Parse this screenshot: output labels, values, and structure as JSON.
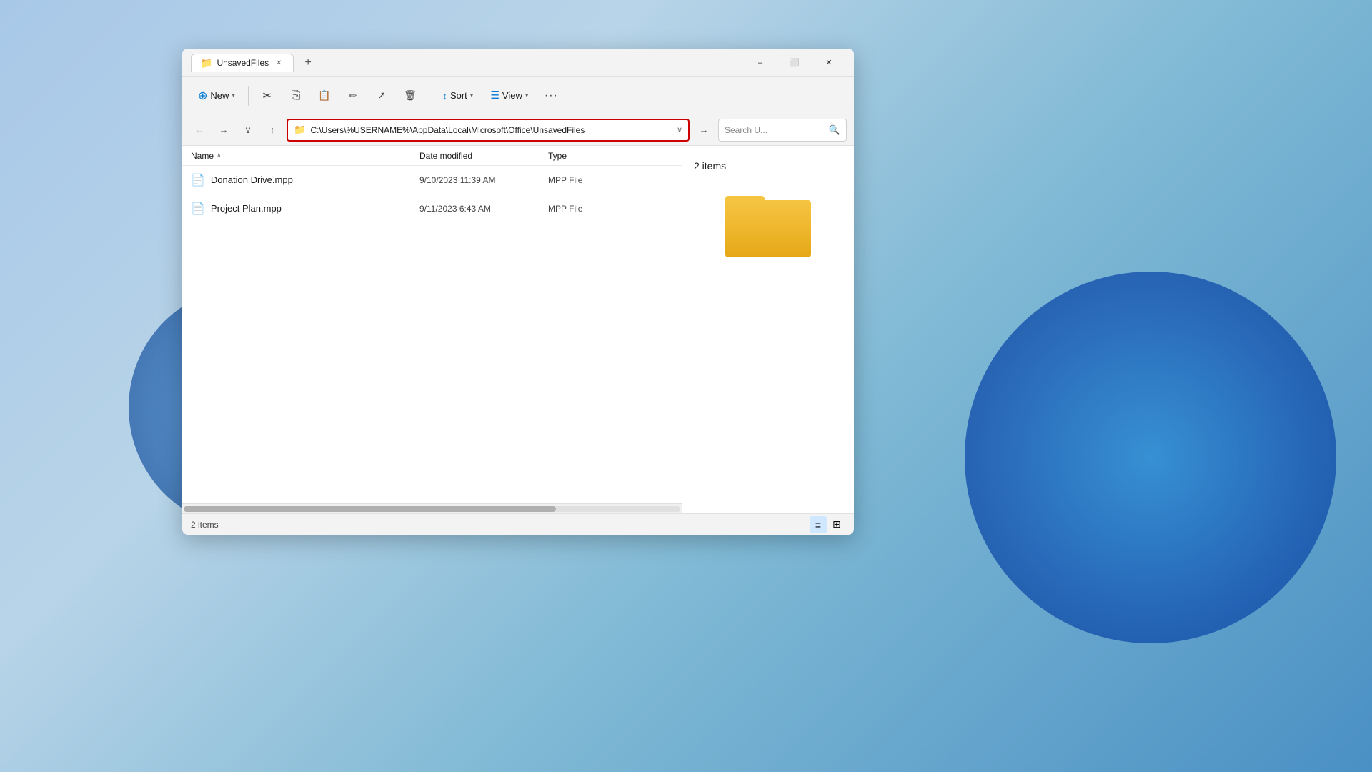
{
  "background": {
    "description": "Windows 11 blue swirl wallpaper"
  },
  "window": {
    "title": "UnsavedFiles",
    "tab_label": "UnsavedFiles",
    "tab_add_label": "+",
    "controls": {
      "minimize": "–",
      "maximize": "⬜",
      "close": "✕"
    }
  },
  "toolbar": {
    "new_label": "New",
    "new_icon": "⊕",
    "cut_icon": "✂",
    "copy_icon": "⎘",
    "paste_icon": "📋",
    "rename_icon": "✏",
    "share_icon": "↗",
    "delete_icon": "🗑",
    "sort_label": "Sort",
    "sort_icon": "↕",
    "view_label": "View",
    "view_icon": "☰",
    "more_icon": "•••"
  },
  "addressbar": {
    "back_icon": "←",
    "forward_icon": "→",
    "dropdown_icon": "∨",
    "up_icon": "↑",
    "path": "C:\\Users\\%USERNAME%\\AppData\\Local\\Microsoft\\Office\\UnsavedFiles",
    "go_icon": "→",
    "search_placeholder": "Search U...",
    "search_icon": "🔍"
  },
  "columns": {
    "name": "Name",
    "sort_arrow": "∧",
    "date_modified": "Date modified",
    "type": "Type"
  },
  "files": [
    {
      "name": "Donation Drive.mpp",
      "date": "9/10/2023 11:39 AM",
      "type": "MPP File"
    },
    {
      "name": "Project Plan.mpp",
      "date": "9/11/2023 6:43 AM",
      "type": "MPP File"
    }
  ],
  "preview": {
    "count_label": "2 items"
  },
  "statusbar": {
    "count_label": "2 items",
    "list_view_icon": "≡",
    "grid_view_icon": "⊞"
  }
}
